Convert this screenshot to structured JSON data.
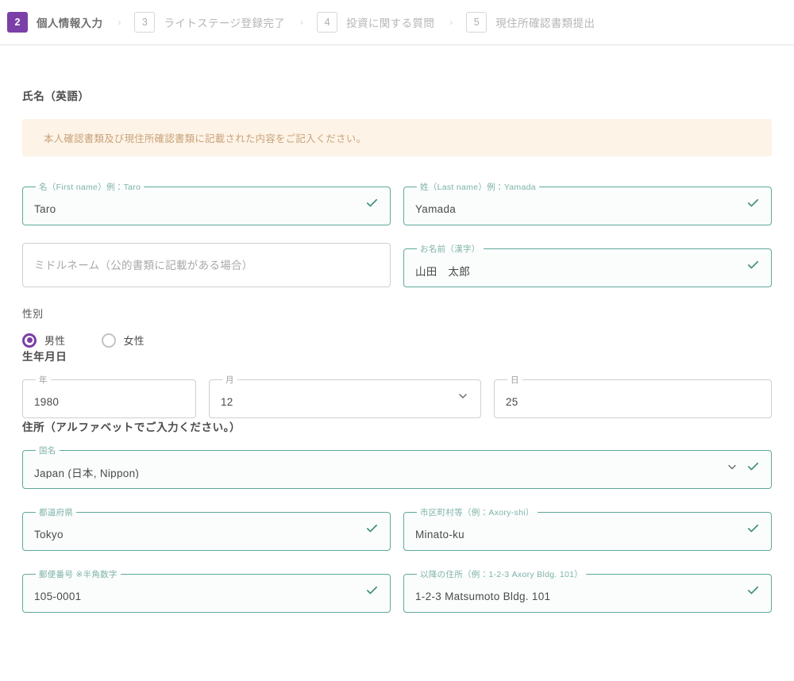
{
  "stepper": {
    "steps": [
      {
        "number": "2",
        "label": "個人情報入力",
        "state": "active"
      },
      {
        "number": "3",
        "label": "ライトステージ登録完了",
        "state": "inactive"
      },
      {
        "number": "4",
        "label": "投資に関する質問",
        "state": "inactive"
      },
      {
        "number": "5",
        "label": "現住所確認書類提出",
        "state": "inactive"
      }
    ],
    "separator": "›"
  },
  "name_section": {
    "title": "氏名（英語）",
    "notice": "本人確認書類及び現住所確認書類に記載された内容をご記入ください。",
    "first_name": {
      "label": "名（First name）例：Taro",
      "value": "Taro"
    },
    "last_name": {
      "label": "姓（Last name）例：Yamada",
      "value": "Yamada"
    },
    "middle_name": {
      "label": "",
      "placeholder": "ミドルネーム（公的書類に記載がある場合）",
      "value": ""
    },
    "kanji_name": {
      "label": "お名前（漢字）",
      "value": "山田　太郎"
    }
  },
  "gender": {
    "label": "性別",
    "options": [
      {
        "label": "男性",
        "selected": true
      },
      {
        "label": "女性",
        "selected": false
      }
    ]
  },
  "birthdate": {
    "title": "生年月日",
    "year": {
      "label": "年",
      "value": "1980"
    },
    "month": {
      "label": "月",
      "value": "12"
    },
    "day": {
      "label": "日",
      "value": "25"
    }
  },
  "address": {
    "title": "住所（アルファベットでご入力ください。）",
    "country": {
      "label": "国名",
      "value": "Japan (日本, Nippon)"
    },
    "prefecture": {
      "label": "都道府県",
      "value": "Tokyo"
    },
    "city": {
      "label": "市区町村等（例：Axory-shi）",
      "value": "Minato-ku"
    },
    "postal_code": {
      "label": "郵便番号 ※半角数字",
      "value": "105-0001"
    },
    "street": {
      "label": "以降の住所（例：1-2-3 Axory Bldg. 101）",
      "value": "1-2-3 Matsumoto Bldg. 101"
    }
  },
  "colors": {
    "accent_purple": "#7b3fa8",
    "valid_teal": "#5fa99a",
    "notice_bg": "#fdf3e6",
    "notice_text": "#c8a27a"
  }
}
